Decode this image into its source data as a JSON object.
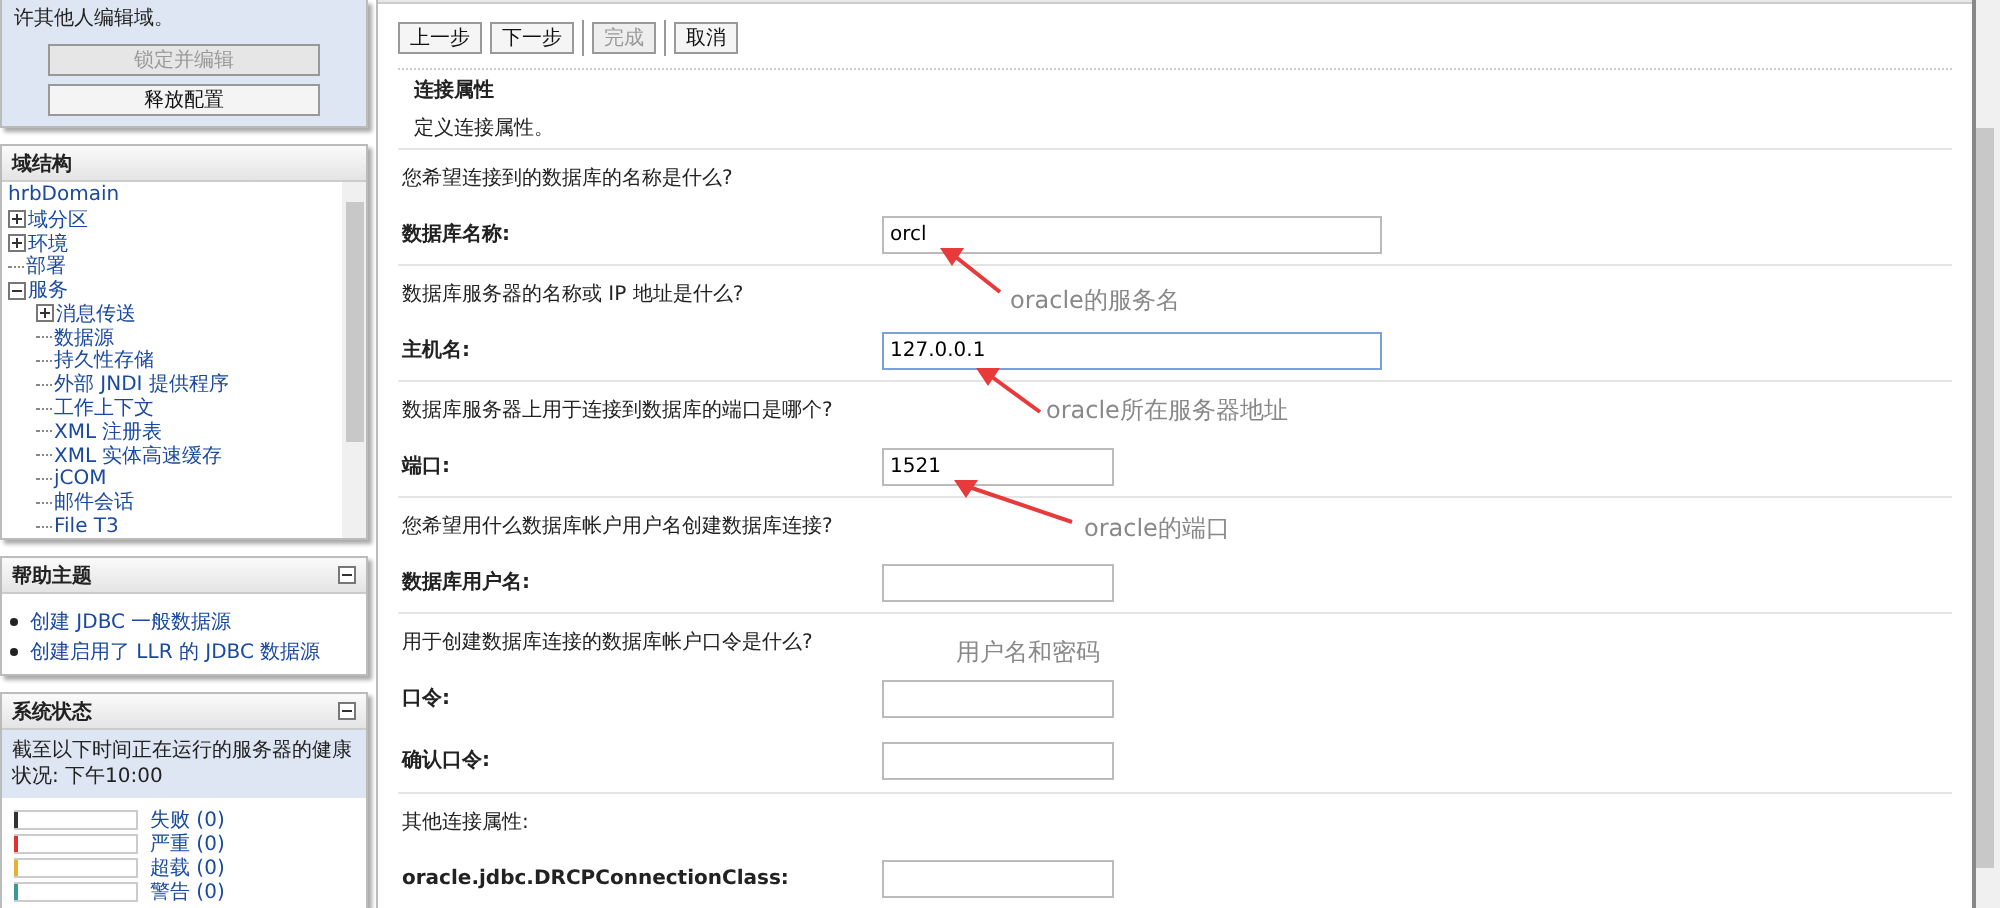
{
  "change_center": {
    "note": "许其他人编辑域。",
    "buttons": [
      {
        "label": "锁定并编辑",
        "disabled": true
      },
      {
        "label": "释放配置",
        "disabled": false
      }
    ]
  },
  "domain_structure": {
    "title": "域结构",
    "tree": [
      {
        "label": "hrbDomain",
        "children": [
          {
            "label": "域分区",
            "expanded": false
          },
          {
            "label": "环境",
            "expanded": false
          },
          {
            "label": "部署"
          },
          {
            "label": "服务",
            "expanded": true,
            "children": [
              {
                "label": "消息传送",
                "expanded": false
              },
              {
                "label": "数据源"
              },
              {
                "label": "持久性存储"
              },
              {
                "label": "外部 JNDI 提供程序"
              },
              {
                "label": "工作上下文"
              },
              {
                "label": "XML 注册表"
              },
              {
                "label": "XML 实体高速缓存"
              },
              {
                "label": "jCOM"
              },
              {
                "label": "邮件会话"
              },
              {
                "label": "File T3"
              }
            ]
          }
        ]
      }
    ]
  },
  "help_topics": {
    "title": "帮助主题",
    "links": [
      "创建 JDBC 一般数据源",
      "创建启用了 LLR 的 JDBC 数据源"
    ]
  },
  "system_status": {
    "title": "系统状态",
    "summary": "截至以下时间正在运行的服务器的健康状况: 下午10:00",
    "items": [
      {
        "label": "失败 (0)",
        "color": "#333333"
      },
      {
        "label": "严重 (0)",
        "color": "#e03030"
      },
      {
        "label": "超载 (0)",
        "color": "#e8b030"
      },
      {
        "label": "警告 (0)",
        "color": "#3a9a9a"
      }
    ]
  },
  "toolbar": [
    {
      "label": "上一步",
      "disabled": false
    },
    {
      "label": "下一步",
      "disabled": false
    },
    {
      "label": "完成",
      "disabled": true
    },
    {
      "label": "取消",
      "disabled": false
    }
  ],
  "section": {
    "title": "连接属性",
    "description": "定义连接属性。"
  },
  "groups": [
    {
      "question": "您希望连接到的数据库的名称是什么?",
      "fields": [
        {
          "label": "数据库名称:",
          "value": "orcl",
          "focused": false
        }
      ]
    },
    {
      "question": "数据库服务器的名称或 IP 地址是什么?",
      "fields": [
        {
          "label": "主机名:",
          "value": "127.0.0.1",
          "focused": true
        }
      ]
    },
    {
      "question": "数据库服务器上用于连接到数据库的端口是哪个?",
      "fields": [
        {
          "label": "端口:",
          "value": "1521",
          "focused": false
        }
      ]
    },
    {
      "question": "您希望用什么数据库帐户用户名创建数据库连接?",
      "fields": [
        {
          "label": "数据库用户名:",
          "focused": false
        }
      ]
    },
    {
      "question": "用于创建数据库连接的数据库帐户口令是什么?",
      "fields": [
        {
          "label": "口令:",
          "focused": false
        },
        {
          "label": "确认口令:",
          "focused": false
        }
      ]
    },
    {
      "question": "其他连接属性:",
      "fields": [
        {
          "label": "oracle.jdbc.DRCPConnectionClass:",
          "focused": false
        }
      ]
    }
  ],
  "annotations": [
    {
      "text": "oracle的服务名",
      "kind": "arrow"
    },
    {
      "text": "oracle所在服务器地址",
      "kind": "arrow"
    },
    {
      "text": "oracle的端口",
      "kind": "arrow"
    },
    {
      "text": "用户名和密码",
      "kind": "plain"
    }
  ]
}
